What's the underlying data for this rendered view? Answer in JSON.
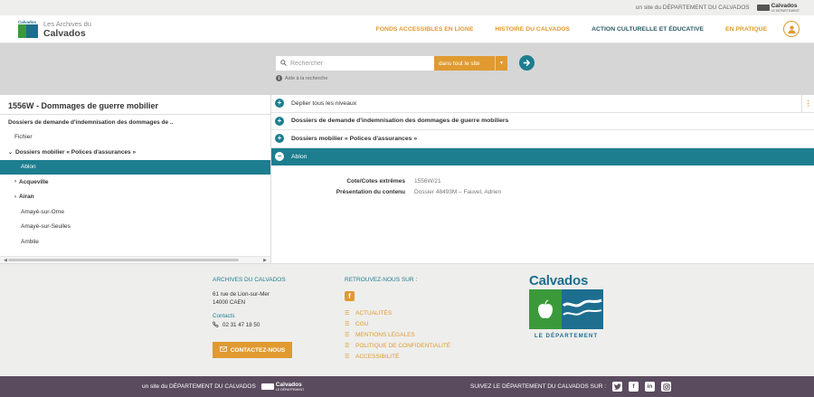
{
  "top_strip": {
    "site_text": "un site du DÉPARTEMENT DU CALVADOS",
    "dept_logo": {
      "name": "Calvados",
      "sub": "LE DÉPARTEMENT"
    }
  },
  "header": {
    "logo_line1": "Les Archives du",
    "logo_line2": "Calvados",
    "logo_mark_text": "Calvados",
    "nav": [
      {
        "label": "FONDS ACCESSIBLES EN LIGNE"
      },
      {
        "label": "HISTOIRE DU CALVADOS"
      },
      {
        "label": "ACTION CULTURELLE ET ÉDUCATIVE"
      },
      {
        "label": "EN PRATIQUE"
      }
    ]
  },
  "search": {
    "placeholder": "Rechercher",
    "scope": "dans tout le site",
    "help": "Aide à la recherche"
  },
  "tree": {
    "title": "1556W - Dommages de guerre mobilier",
    "items": [
      {
        "label": "Dossiers de demande d'indemnisation des dommages de ..",
        "bold": true,
        "indent": 0,
        "arrow": ""
      },
      {
        "label": "Fichier",
        "bold": false,
        "indent": 1,
        "arrow": ""
      },
      {
        "label": "Dossiers mobilier « Polices d'assurances »",
        "bold": true,
        "indent": 0,
        "arrow": "⌄"
      },
      {
        "label": "Ablon",
        "bold": false,
        "indent": 2,
        "arrow": "",
        "active": true
      },
      {
        "label": "Acqueville",
        "bold": true,
        "indent": 1,
        "arrow": "›"
      },
      {
        "label": "Airan",
        "bold": true,
        "indent": 1,
        "arrow": "›"
      },
      {
        "label": "Amayé-sur-Orne",
        "bold": false,
        "indent": 2,
        "arrow": ""
      },
      {
        "label": "Amayé-sur-Seulles",
        "bold": false,
        "indent": 2,
        "arrow": ""
      },
      {
        "label": "Amblie",
        "bold": false,
        "indent": 2,
        "arrow": ""
      }
    ]
  },
  "detail": {
    "rows": [
      {
        "label": "Déplier tous les niveaux",
        "bold": false,
        "symbol": "+"
      },
      {
        "label": "Dossiers de demande d'indemnisation des dommages de guerre mobiliers",
        "bold": true,
        "symbol": "+"
      },
      {
        "label": "Dossiers mobilier « Polices d'assurances »",
        "bold": true,
        "symbol": "+"
      },
      {
        "label": "Ablon",
        "bold": false,
        "symbol": "−",
        "active": true
      }
    ],
    "meta": [
      {
        "key": "Cote/Cotes extrêmes",
        "value": "1556W/21"
      },
      {
        "key": "Présentation du contenu",
        "value": "Dossier 48493M – Fauvel, Adrien"
      }
    ]
  },
  "footer": {
    "col1_title": "ARCHIVES DU CALVADOS",
    "address1": "61 rue de Lion-sur-Mer",
    "address2": "14000 CAEN",
    "contacts": "Contacts",
    "phone": "02 31 47 18 50",
    "contact_button": "CONTACTEZ-NOUS",
    "col2_title": "RETROUVEZ-NOUS SUR :",
    "links": [
      {
        "label": "ACTUALITÉS"
      },
      {
        "label": "CGU"
      },
      {
        "label": "MENTIONS LÉGALES"
      },
      {
        "label": "POLITIQUE DE CONFIDENTIALITÉ"
      },
      {
        "label": "ACCESSIBILITÉ"
      }
    ],
    "big_logo_name": "Calvados",
    "big_logo_sub": "LE DÉPARTEMENT"
  },
  "bottom_bar": {
    "left_text": "un site du DÉPARTEMENT DU CALVADOS",
    "dept_logo": {
      "name": "Calvados",
      "sub": "LE DÉPARTEMENT"
    },
    "right_text": "SUIVEZ LE DÉPARTEMENT DU CALVADOS SUR :",
    "social": [
      "twitter-icon",
      "facebook-icon",
      "linkedin-icon",
      "instagram-icon"
    ]
  },
  "colors": {
    "accent": "#e09a30",
    "teal": "#1d7e8f",
    "bottom_bar": "#5b4b5e"
  }
}
